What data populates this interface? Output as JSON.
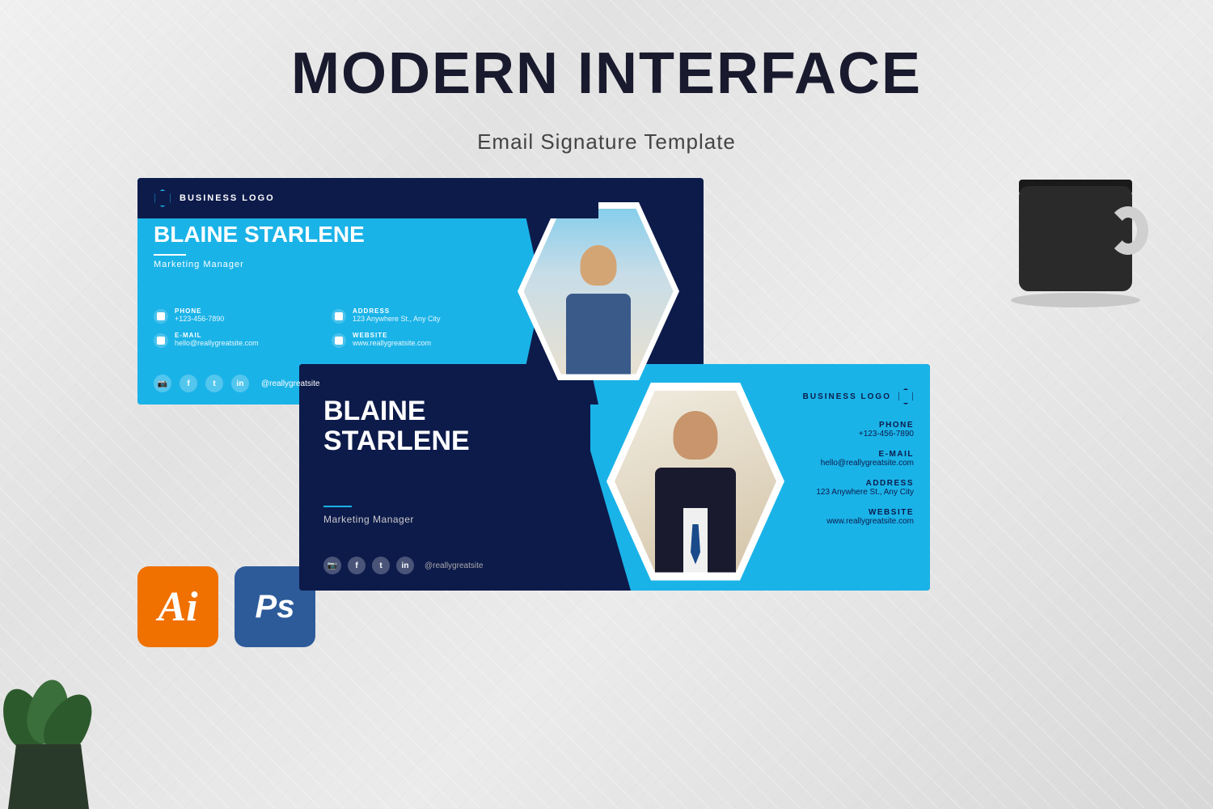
{
  "page": {
    "title": "MODERN INTERFACE",
    "subtitle": "Email Signature Template"
  },
  "card1": {
    "logo_text": "BUSINESS LOGO",
    "name": "BLAINE STARLENE",
    "job_title": "Marketing Manager",
    "phone_label": "PHONE",
    "phone_value": "+123-456-7890",
    "email_label": "E-MAIL",
    "email_value": "hello@reallygreatsite.com",
    "address_label": "ADDRESS",
    "address_value": "123 Anywhere St., Any City",
    "website_label": "WEBSITE",
    "website_value": "www.reallygreatsite.com",
    "social_handle": "@reallygreatsite"
  },
  "card2": {
    "logo_text": "BUSINESS LOGO",
    "name_line1": "BLAINE",
    "name_line2": "STARLENE",
    "job_title": "Marketing Manager",
    "phone_label": "PHONE",
    "phone_value": "+123-456-7890",
    "email_label": "E-MAIL",
    "email_value": "hello@reallygreatsite.com",
    "address_label": "ADDRESS",
    "address_value": "123 Anywhere St., Any City",
    "website_label": "WEBSITE",
    "website_value": "www.reallygreatsite.com",
    "social_handle": "@reallygreatsite"
  },
  "tools": {
    "ai_label": "Ai",
    "ps_label": "Ps"
  },
  "colors": {
    "dark_navy": "#0d1b4b",
    "cyan_blue": "#1ab3e8",
    "orange": "#f07000",
    "photoshop_blue": "#2d5b9a",
    "white": "#ffffff"
  }
}
